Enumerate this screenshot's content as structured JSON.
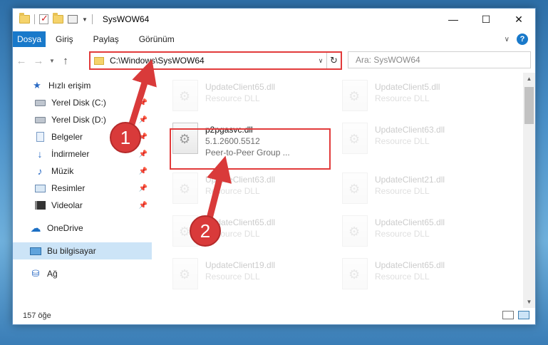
{
  "window": {
    "title": "SysWOW64",
    "controls": {
      "minimize": "—",
      "maximize": "☐",
      "close": "✕"
    }
  },
  "ribbon": {
    "tabs": [
      "Dosya",
      "Giriş",
      "Paylaş",
      "Görünüm"
    ],
    "help": "?"
  },
  "navigation": {
    "address": "C:\\Windows\\SysWOW64",
    "search_placeholder": "Ara: SysWOW64"
  },
  "sidebar": {
    "items": [
      {
        "label": "Hızlı erişim",
        "icon": "star-icon",
        "pinned": false
      },
      {
        "label": "Yerel Disk (C:)",
        "icon": "drive-icon",
        "pinned": true
      },
      {
        "label": "Yerel Disk (D:)",
        "icon": "drive-icon",
        "pinned": true
      },
      {
        "label": "Belgeler",
        "icon": "documents-icon",
        "pinned": true
      },
      {
        "label": "İndirmeler",
        "icon": "downloads-icon",
        "pinned": true
      },
      {
        "label": "Müzik",
        "icon": "music-icon",
        "pinned": true
      },
      {
        "label": "Resimler",
        "icon": "pictures-icon",
        "pinned": true
      },
      {
        "label": "Videolar",
        "icon": "videos-icon",
        "pinned": true
      },
      {
        "label": "OneDrive",
        "icon": "cloud-icon",
        "pinned": false
      },
      {
        "label": "Bu bilgisayar",
        "icon": "computer-icon",
        "pinned": false,
        "selected": true
      },
      {
        "label": "Ağ",
        "icon": "network-icon",
        "pinned": false
      }
    ]
  },
  "files": [
    {
      "name": "UpdateClient65.dll",
      "line2": "Resource DLL",
      "faded": true
    },
    {
      "name": "UpdateClient5.dll",
      "line2": "Resource DLL",
      "faded": true
    },
    {
      "name": "p2pgasvc.dll",
      "line2": "5.1.2600.5512",
      "line3": "Peer-to-Peer Group ...",
      "faded": false
    },
    {
      "name": "UpdateClient63.dll",
      "line2": "Resource DLL",
      "faded": true
    },
    {
      "name": "UpdateClient63.dll",
      "line2": "Resource DLL",
      "faded": true
    },
    {
      "name": "UpdateClient21.dll",
      "line2": "Resource DLL",
      "faded": true
    },
    {
      "name": "UpdateClient65.dll",
      "line2": "Resource DLL",
      "faded": true
    },
    {
      "name": "UpdateClient65.dll",
      "line2": "Resource DLL",
      "faded": true
    },
    {
      "name": "UpdateClient19.dll",
      "line2": "Resource DLL",
      "faded": true
    },
    {
      "name": "UpdateClient65.dll",
      "line2": "Resource DLL",
      "faded": true
    }
  ],
  "status": {
    "count": "157 öğe"
  },
  "annotations": {
    "badge_1": "1",
    "badge_2": "2",
    "color": "#d93a3a"
  }
}
